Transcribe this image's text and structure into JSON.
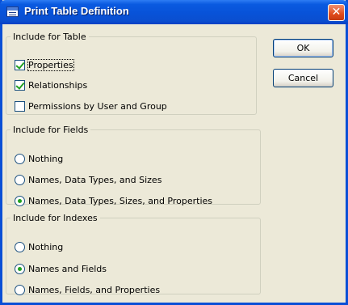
{
  "window": {
    "title": "Print Table Definition",
    "close_symbol": "✕"
  },
  "table_group": {
    "legend": "Include for Table",
    "items": [
      {
        "label": "Properties",
        "checked": true
      },
      {
        "label": "Relationships",
        "checked": true
      },
      {
        "label": "Permissions by User and Group",
        "checked": false
      }
    ]
  },
  "fields_group": {
    "legend": "Include for Fields",
    "options": [
      {
        "label": "Nothing",
        "selected": false
      },
      {
        "label": "Names, Data Types, and Sizes",
        "selected": false
      },
      {
        "label": "Names, Data Types, Sizes, and Properties",
        "selected": true
      }
    ]
  },
  "indexes_group": {
    "legend": "Include for Indexes",
    "options": [
      {
        "label": "Nothing",
        "selected": false
      },
      {
        "label": "Names and Fields",
        "selected": true
      },
      {
        "label": "Names, Fields, and Properties",
        "selected": false
      }
    ]
  },
  "buttons": {
    "ok": "OK",
    "cancel": "Cancel"
  },
  "colors": {
    "title_bar": "#0a56dd",
    "dialog_bg": "#ece9d8",
    "check_green": "#21a121",
    "close_red": "#e04b1c"
  }
}
